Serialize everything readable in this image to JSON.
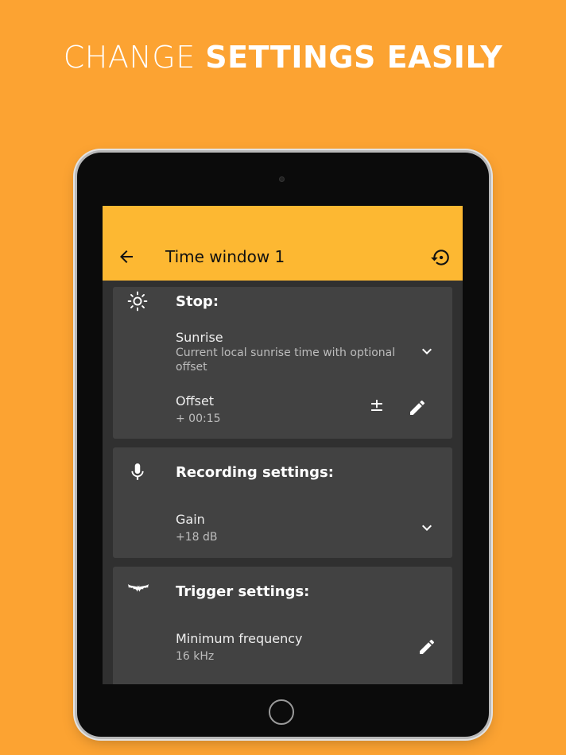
{
  "headline": {
    "light": "CHANGE ",
    "bold": "SETTINGS EASILY"
  },
  "appbar": {
    "title": "Time window 1"
  },
  "stop_section": {
    "title": "Stop:",
    "mode_title": "Sunrise",
    "mode_desc": "Current local sunrise time with optional offset",
    "offset_label": "Offset",
    "offset_value": "+ 00:15",
    "plusminus": "±"
  },
  "recording_section": {
    "title": "Recording settings:",
    "gain_label": "Gain",
    "gain_value": "+18 dB"
  },
  "trigger_section": {
    "title": "Trigger settings:",
    "minfreq_label": "Minimum frequency",
    "minfreq_value": "16 kHz"
  },
  "colors": {
    "background": "#FCA332",
    "appbar": "#FDB832",
    "screen": "#303030",
    "card": "#424242"
  },
  "icons": [
    "arrow-back-icon",
    "restore-icon",
    "sun-icon",
    "chevron-down-icon",
    "edit-icon",
    "microphone-icon",
    "bat-icon"
  ]
}
